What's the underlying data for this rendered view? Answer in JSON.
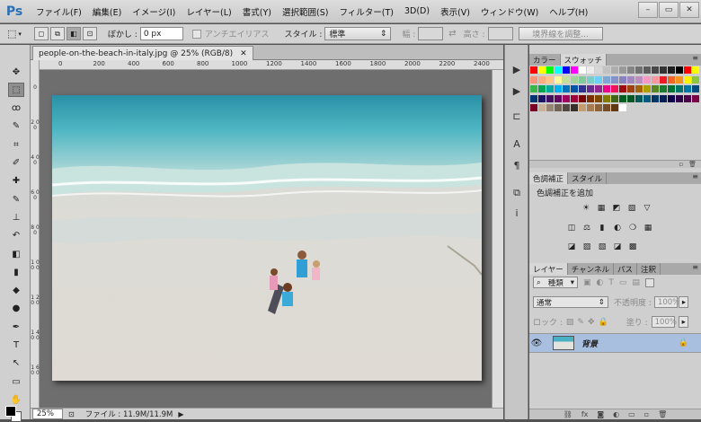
{
  "app": {
    "logo": "Ps"
  },
  "menu": [
    "ファイル(F)",
    "編集(E)",
    "イメージ(I)",
    "レイヤー(L)",
    "書式(Y)",
    "選択範囲(S)",
    "フィルター(T)",
    "3D(D)",
    "表示(V)",
    "ウィンドウ(W)",
    "ヘルプ(H)"
  ],
  "window_controls": {
    "minimize": "–",
    "maximize": "▭",
    "close": "✕"
  },
  "options": {
    "feather_label": "ぼかし :",
    "feather_value": "0 px",
    "antialias_label": "アンチエイリアス",
    "style_label": "スタイル :",
    "style_value": "標準",
    "width_label": "幅 :",
    "height_label": "高さ :",
    "refine_button": "境界線を調整..."
  },
  "document": {
    "tab_title": "people-on-the-beach-in-italy.jpg @ 25% (RGB/8)",
    "tab_close": "✕",
    "ruler_h": [
      "0",
      "200",
      "400",
      "600",
      "800",
      "1000",
      "1200",
      "1400",
      "1600",
      "1800",
      "2000",
      "2200",
      "2400"
    ],
    "ruler_v": [
      "0",
      "2 0 0",
      "4 0 0",
      "6 0 0",
      "8 0 0",
      "1 0 0 0",
      "1 2 0 0",
      "1 4 0 0",
      "1 6 0 0"
    ],
    "zoom": "25%",
    "file_info": "ファイル : 11.9M/11.9M"
  },
  "tools": [
    "move-tool",
    "marquee-tool",
    "lasso-tool",
    "quick-select-tool",
    "crop-tool",
    "eyedropper-tool",
    "healing-brush-tool",
    "brush-tool",
    "clone-stamp-tool",
    "history-brush-tool",
    "eraser-tool",
    "gradient-tool",
    "blur-tool",
    "dodge-tool",
    "pen-tool",
    "type-tool",
    "path-select-tool",
    "shape-tool",
    "hand-tool"
  ],
  "tool_glyphs": [
    "✥",
    "⬚",
    "ꝏ",
    "✎",
    "⌗",
    "✐",
    "✚",
    "✎",
    "⊥",
    "↶",
    "◧",
    "▮",
    "◆",
    "●",
    "✒",
    "T",
    "↖",
    "▭",
    "✋"
  ],
  "panels": {
    "color_tabs": [
      "カラー",
      "スウォッチ"
    ],
    "adjust_tabs": [
      "色調補正",
      "スタイル"
    ],
    "adjust_title": "色調補正を追加",
    "layers_tabs": [
      "レイヤー",
      "チャンネル",
      "パス",
      "注釈"
    ],
    "filter_kind": "種類",
    "blend_mode": "通常",
    "opacity_label": "不透明度 :",
    "opacity_value": "100%",
    "lock_label": "ロック :",
    "fill_label": "塗り :",
    "fill_value": "100%",
    "layer_name": "背景"
  },
  "swatches": [
    [
      "#ff0000",
      "#ffff00",
      "#00ff00",
      "#00ffff",
      "#0000ff",
      "#ff00ff",
      "#ffffff",
      "#ebebeb",
      "#d6d6d6",
      "#c2c2c2",
      "#adadad",
      "#999999",
      "#858585",
      "#707070",
      "#5c5c5c",
      "#474747",
      "#333333",
      "#1f1f1f",
      "#000000",
      "#ff0000",
      "#ffff00"
    ],
    [
      "#f7977a",
      "#f9ad81",
      "#fdc68a",
      "#fff79a",
      "#c4df9b",
      "#a3d39c",
      "#82ca9d",
      "#7bcdc8",
      "#6ecff6",
      "#7ea7d8",
      "#8493ca",
      "#8882be",
      "#a187be",
      "#bc8dbf",
      "#f49ac2",
      "#f6989d",
      "#ed1c24",
      "#f26522",
      "#f7941d",
      "#fff200",
      "#8dc63f"
    ],
    [
      "#39b54a",
      "#00a651",
      "#00a99d",
      "#00aeef",
      "#0072bc",
      "#0054a6",
      "#2e3192",
      "#662d91",
      "#92278f",
      "#ec008c",
      "#ed145b",
      "#9e0b0f",
      "#a0410d",
      "#a3620a",
      "#aba000",
      "#598527",
      "#1a7b30",
      "#007236",
      "#00746b",
      "#0076a3",
      "#004b80"
    ],
    [
      "#003471",
      "#1b1464",
      "#440e62",
      "#630460",
      "#9e005d",
      "#9e0039",
      "#790000",
      "#7b2e00",
      "#7d4900",
      "#827b00",
      "#406618",
      "#005e20",
      "#005826",
      "#005952",
      "#005b7f",
      "#003663",
      "#002157",
      "#0d004c",
      "#32004b",
      "#4b0049",
      "#7b0046"
    ],
    [
      "#7a0026",
      "#c7b299",
      "#998675",
      "#736357",
      "#534741",
      "#37302a",
      "#c69c6d",
      "#a67c52",
      "#8c6239",
      "#754c24",
      "#603913",
      "#ffffff",
      "#cfcfcf",
      "#cfcfcf",
      "#cfcfcf",
      "#cfcfcf",
      "#cfcfcf",
      "#cfcfcf",
      "#cfcfcf",
      "#cfcfcf",
      "#cfcfcf"
    ]
  ],
  "adjust_icons": [
    [
      "☀",
      "▦",
      "◩",
      "▧",
      "▽"
    ],
    [
      "◫",
      "⚖",
      "▮",
      "◐",
      "❍",
      "▦"
    ],
    [
      "◪",
      "▨",
      "▧",
      "◪",
      "▩"
    ]
  ],
  "strip_icons": [
    "▶",
    "▶",
    "⊏",
    "A",
    "¶",
    "⧉",
    "i"
  ]
}
